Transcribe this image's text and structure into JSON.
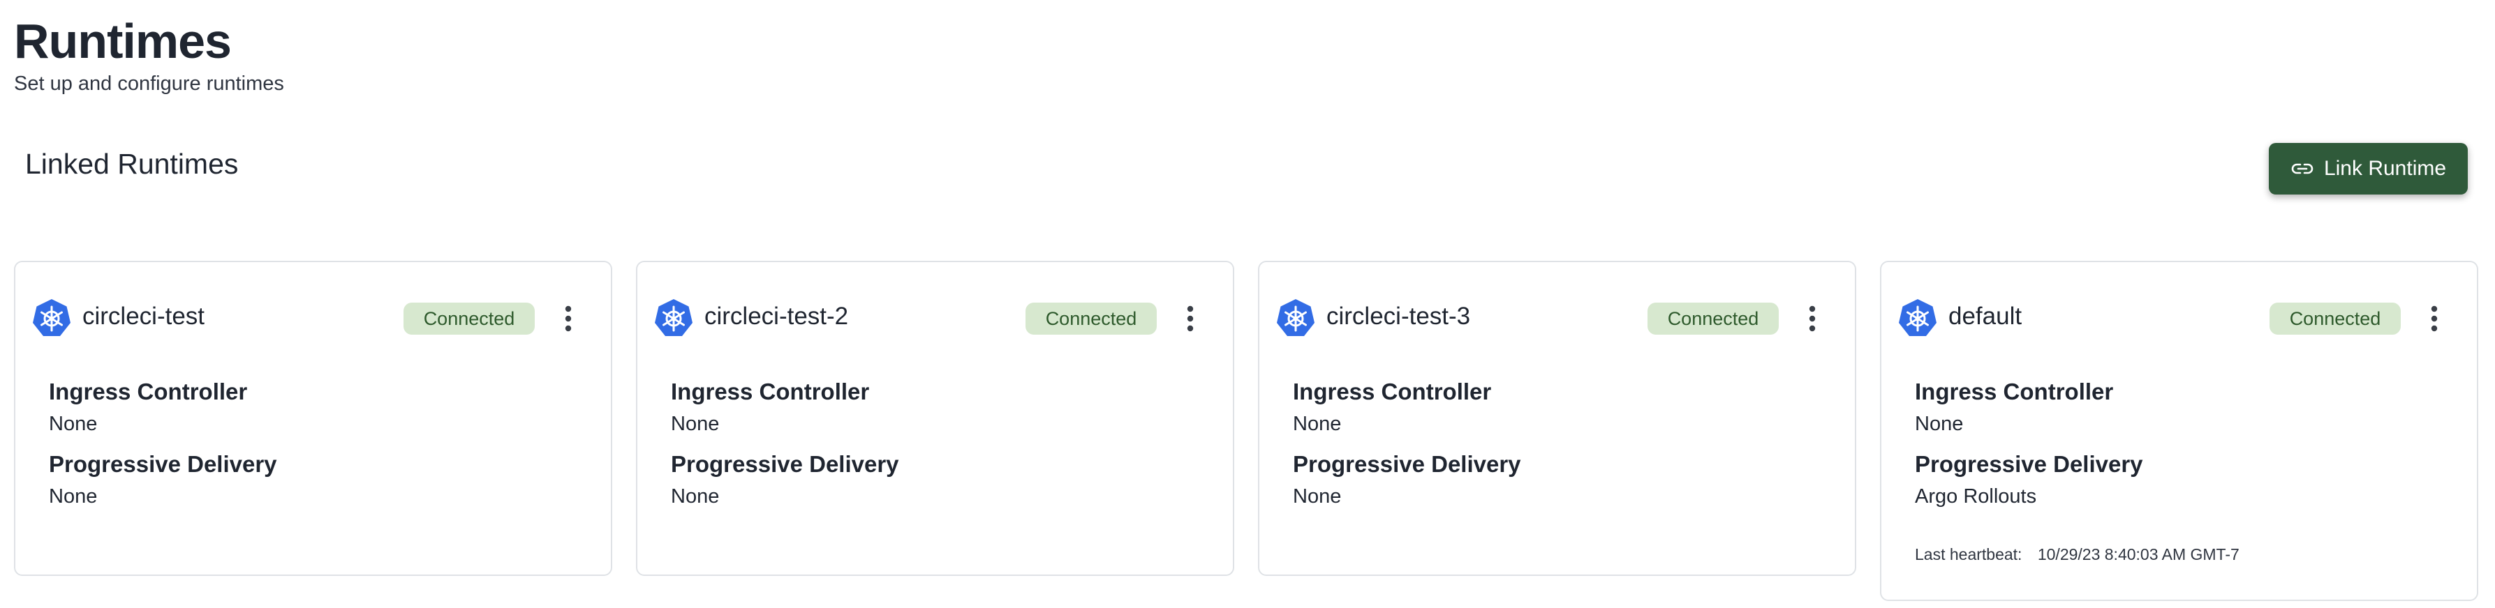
{
  "page": {
    "title": "Runtimes",
    "subtitle": "Set up and configure runtimes"
  },
  "section": {
    "title": "Linked Runtimes",
    "link_button_label": "Link Runtime",
    "link_button_icon": "link-icon"
  },
  "colors": {
    "primary_button": "#2f5a3a",
    "badge_bg": "#d7e8cf",
    "badge_text": "#2e5a2c",
    "k8s_icon": "#326ce5"
  },
  "cards": [
    {
      "name": "circleci-test",
      "status": "Connected",
      "icon": "kubernetes-icon",
      "ingress_label": "Ingress Controller",
      "ingress_value": "None",
      "progressive_label": "Progressive Delivery",
      "progressive_value": "None"
    },
    {
      "name": "circleci-test-2",
      "status": "Connected",
      "icon": "kubernetes-icon",
      "ingress_label": "Ingress Controller",
      "ingress_value": "None",
      "progressive_label": "Progressive Delivery",
      "progressive_value": "None"
    },
    {
      "name": "circleci-test-3",
      "status": "Connected",
      "icon": "kubernetes-icon",
      "ingress_label": "Ingress Controller",
      "ingress_value": "None",
      "progressive_label": "Progressive Delivery",
      "progressive_value": "None"
    },
    {
      "name": "default",
      "status": "Connected",
      "icon": "kubernetes-icon",
      "ingress_label": "Ingress Controller",
      "ingress_value": "None",
      "progressive_label": "Progressive Delivery",
      "progressive_value": "Argo Rollouts",
      "heartbeat_label": "Last heartbeat:",
      "heartbeat_value": "10/29/23 8:40:03 AM GMT-7"
    }
  ]
}
